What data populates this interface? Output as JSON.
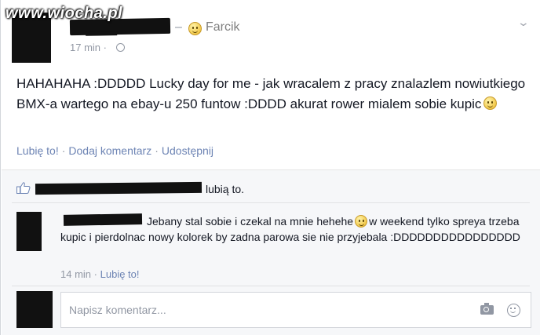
{
  "watermark": "www.wiocha.pl",
  "post": {
    "feeling_dash": "–",
    "feeling_label": "Farcik",
    "timestamp": "17 min",
    "timestamp_sep": "·",
    "text": "HAHAHAHA :DDDDD Lucky day for me - jak wracalem z pracy znalazlem nowiutkiego BMX-a wartego na ebay-u 250 funtow :DDDD akurat rower mialem sobie kupic",
    "actions": {
      "like": "Lubię to!",
      "comment": "Dodaj komentarz",
      "share": "Udostępnij",
      "sep": "·"
    }
  },
  "likes": {
    "text": "lubią to."
  },
  "comment": {
    "text_part1": "Jebany stal sobie i czekal na mnie hehehe",
    "text_part2": "w weekend tylko spreya trzeba kupic i pierdolnac nowy kolorek by zadna parowa sie nie przyjebala :DDDDDDDDDDDDDDDD",
    "timestamp": "14 min",
    "sep": "·",
    "like": "Lubię to!"
  },
  "composer": {
    "placeholder": "Napisz komentarz..."
  },
  "colors": {
    "link": "#6d84b4",
    "meta": "#9197a3",
    "ufi_background": "#f6f7f9"
  }
}
